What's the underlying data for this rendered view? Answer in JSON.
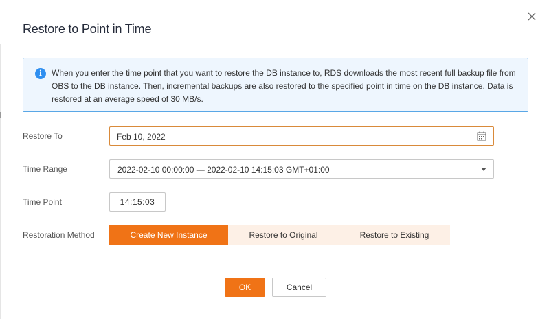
{
  "dialog": {
    "title": "Restore to Point in Time",
    "close_icon": "close-icon"
  },
  "info": {
    "icon": "info-icon",
    "icon_glyph": "i",
    "text": "When you enter the time point that you want to restore the DB instance to, RDS downloads the most recent full backup file from OBS to the DB instance. Then, incremental backups are also restored to the specified point in time on the DB instance. Data is restored at an average speed of 30 MB/s."
  },
  "form": {
    "restore_to_label": "Restore To",
    "restore_to_value": "Feb 10, 2022",
    "calendar_icon": "calendar-icon",
    "time_range_label": "Time Range",
    "time_range_value": "2022-02-10 00:00:00 — 2022-02-10 14:15:03 GMT+01:00",
    "time_point_label": "Time Point",
    "time_point_value": "14:15:03",
    "restoration_method_label": "Restoration Method",
    "methods": [
      {
        "label": "Create New Instance",
        "selected": true
      },
      {
        "label": "Restore to Original",
        "selected": false
      },
      {
        "label": "Restore to Existing",
        "selected": false
      }
    ]
  },
  "footer": {
    "ok_label": "OK",
    "cancel_label": "Cancel"
  },
  "colors": {
    "accent": "#f07316",
    "info_border": "#5aa7e6",
    "info_bg": "#eef6fe",
    "info_icon": "#2f8ff0",
    "segment_unselected_bg": "#fdf0e6"
  }
}
